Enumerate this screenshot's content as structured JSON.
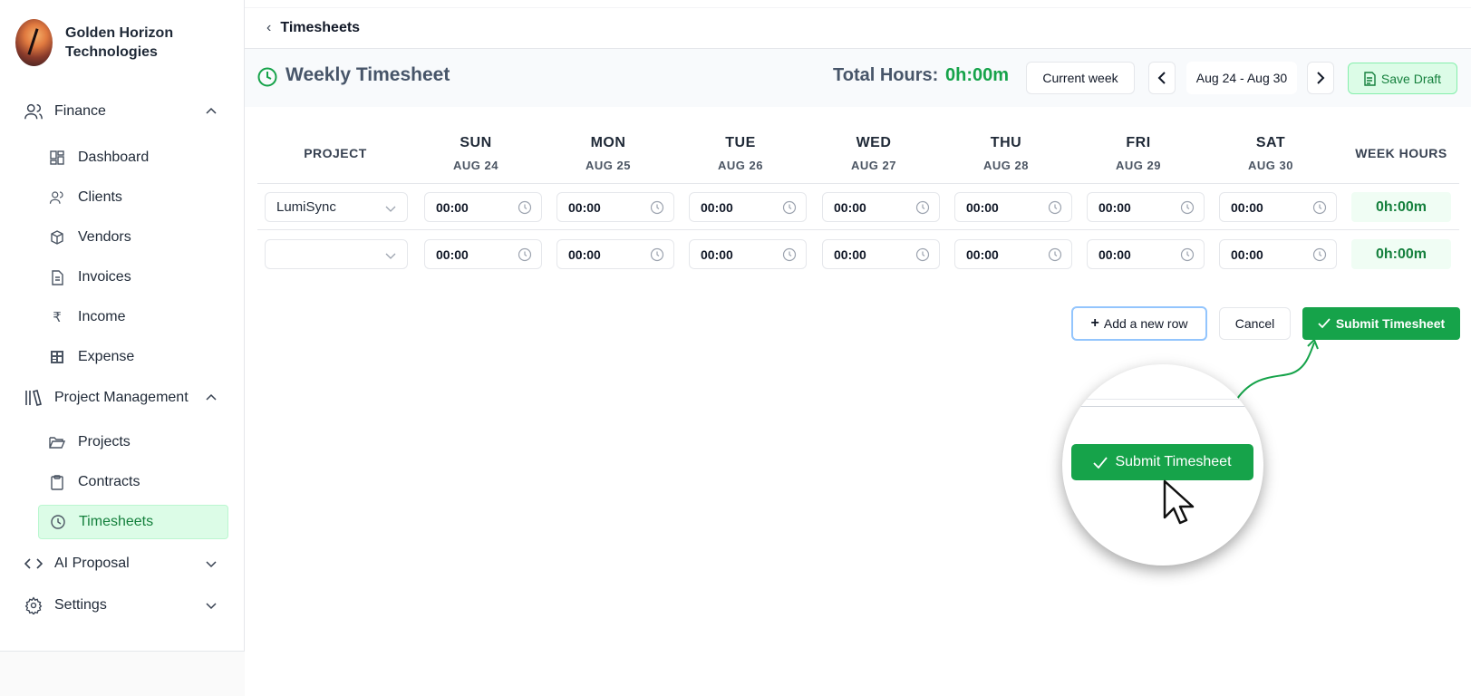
{
  "sidebar": {
    "company_name": "Golden Horizon Technologies",
    "groups": [
      {
        "label": "Finance",
        "icon": "users-icon",
        "expanded": true
      },
      {
        "label": "Project Management",
        "icon": "library-icon",
        "expanded": true
      },
      {
        "label": "AI Proposal",
        "icon": "code-icon",
        "expanded": false
      },
      {
        "label": "Settings",
        "icon": "gear-icon",
        "expanded": false
      }
    ],
    "finance_items": [
      {
        "label": "Dashboard",
        "icon": "dashboard-icon"
      },
      {
        "label": "Clients",
        "icon": "users-icon"
      },
      {
        "label": "Vendors",
        "icon": "box-icon"
      },
      {
        "label": "Invoices",
        "icon": "file-icon"
      },
      {
        "label": "Income",
        "icon": "rupee-icon",
        "glyph": "₹"
      },
      {
        "label": "Expense",
        "icon": "calculator-icon"
      }
    ],
    "pm_items": [
      {
        "label": "Projects",
        "icon": "folder-open-icon"
      },
      {
        "label": "Contracts",
        "icon": "clipboard-icon"
      },
      {
        "label": "Timesheets",
        "icon": "clock-icon",
        "active": true
      }
    ]
  },
  "topbar": {
    "breadcrumb": "Timesheets",
    "back_glyph": "‹"
  },
  "header": {
    "title": "Weekly Timesheet",
    "total_label": "Total Hours:",
    "total_value": "0h:00m",
    "current_week": "Current week",
    "date_range": "Aug 24 - Aug 30",
    "save_draft": "Save Draft"
  },
  "table": {
    "project_header": "PROJECT",
    "week_hours_header": "WEEK HOURS",
    "days": [
      {
        "day": "SUN",
        "date": "AUG 24"
      },
      {
        "day": "MON",
        "date": "AUG 25"
      },
      {
        "day": "TUE",
        "date": "AUG 26"
      },
      {
        "day": "WED",
        "date": "AUG 27"
      },
      {
        "day": "THU",
        "date": "AUG 28"
      },
      {
        "day": "FRI",
        "date": "AUG 29"
      },
      {
        "day": "SAT",
        "date": "AUG 30"
      }
    ],
    "rows": [
      {
        "project": "LumiSync",
        "times": [
          "00:00",
          "00:00",
          "00:00",
          "00:00",
          "00:00",
          "00:00",
          "00:00"
        ],
        "week_hours": "0h:00m"
      },
      {
        "project": "",
        "times": [
          "00:00",
          "00:00",
          "00:00",
          "00:00",
          "00:00",
          "00:00",
          "00:00"
        ],
        "week_hours": "0h:00m"
      }
    ]
  },
  "actions": {
    "add_row": "Add a new row",
    "cancel": "Cancel",
    "submit": "Submit Timesheet"
  },
  "zoom_callout": {
    "button_label": "Submit Timesheet"
  },
  "colors": {
    "accent": "#16a34a",
    "active_bg": "#dcfce7",
    "title": "#475569"
  }
}
